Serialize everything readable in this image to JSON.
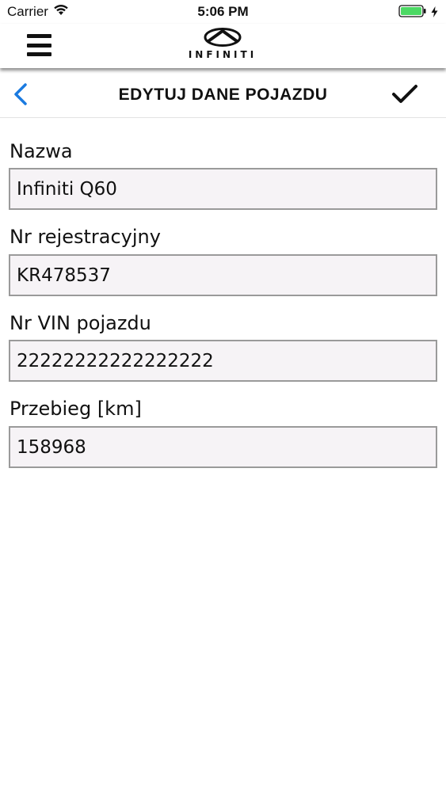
{
  "status_bar": {
    "carrier": "Carrier",
    "time": "5:06 PM",
    "battery_color": "#4cd964"
  },
  "header": {
    "menu_icon": "hamburger-menu-icon",
    "brand": "INFINITI"
  },
  "title_bar": {
    "title": "EDYTUJ DANE POJAZDU",
    "back_icon": "chevron-left-icon",
    "back_color": "#1a7ae0",
    "confirm_icon": "checkmark-icon"
  },
  "form": {
    "fields": [
      {
        "label": "Nazwa",
        "value": "Infiniti Q60"
      },
      {
        "label": "Nr rejestracyjny",
        "value": "KR478537"
      },
      {
        "label": "Nr VIN pojazdu",
        "value": "22222222222222222"
      },
      {
        "label": "Przebieg [km]",
        "value": "158968"
      }
    ]
  }
}
